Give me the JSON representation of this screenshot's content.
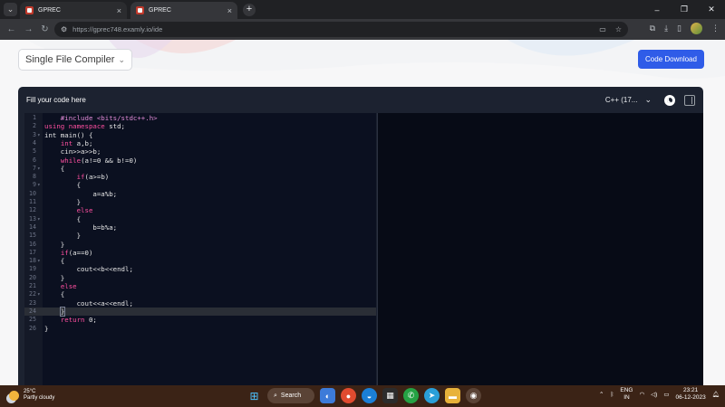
{
  "browser": {
    "tabs": [
      {
        "title": "GPREC",
        "close": "×"
      },
      {
        "title": "GPREC",
        "close": "×"
      }
    ],
    "new_tab": "+",
    "url": "https://gprec748.examly.io/ide",
    "window_controls": {
      "minimize": "–",
      "maximize": "❐",
      "close": "✕"
    }
  },
  "page": {
    "mode_select": {
      "value": "Single File Compiler",
      "chevron": "⌄"
    },
    "download_button": "Code Download",
    "panel": {
      "title": "Fill your code here",
      "language": "C++ (17...",
      "language_chevron": "⌄"
    },
    "code": [
      {
        "n": "1",
        "text": "    #include <bits/stdc++.h>",
        "fold": ""
      },
      {
        "n": "2",
        "text": "using namespace std;",
        "fold": ""
      },
      {
        "n": "3",
        "text": "int main() {",
        "fold": "▾"
      },
      {
        "n": "4",
        "text": "    int a,b;",
        "fold": ""
      },
      {
        "n": "5",
        "text": "    cin>>a>>b;",
        "fold": ""
      },
      {
        "n": "6",
        "text": "    while(a!=0 && b!=0)",
        "fold": ""
      },
      {
        "n": "7",
        "text": "    {",
        "fold": "▾"
      },
      {
        "n": "8",
        "text": "        if(a>=b)",
        "fold": ""
      },
      {
        "n": "9",
        "text": "        {",
        "fold": "▾"
      },
      {
        "n": "10",
        "text": "            a=a%b;",
        "fold": ""
      },
      {
        "n": "11",
        "text": "        }",
        "fold": ""
      },
      {
        "n": "12",
        "text": "        else",
        "fold": ""
      },
      {
        "n": "13",
        "text": "        {",
        "fold": "▾"
      },
      {
        "n": "14",
        "text": "            b=b%a;",
        "fold": ""
      },
      {
        "n": "15",
        "text": "        }",
        "fold": ""
      },
      {
        "n": "16",
        "text": "    }",
        "fold": ""
      },
      {
        "n": "17",
        "text": "    if(a==0)",
        "fold": ""
      },
      {
        "n": "18",
        "text": "    {",
        "fold": "▾"
      },
      {
        "n": "19",
        "text": "        cout<<b<<endl;",
        "fold": ""
      },
      {
        "n": "20",
        "text": "    }",
        "fold": ""
      },
      {
        "n": "21",
        "text": "    else",
        "fold": ""
      },
      {
        "n": "22",
        "text": "    {",
        "fold": "▾"
      },
      {
        "n": "23",
        "text": "        cout<<a<<endl;",
        "fold": ""
      },
      {
        "n": "24",
        "text": "    }",
        "fold": ""
      },
      {
        "n": "25",
        "text": "    return 0;",
        "fold": ""
      },
      {
        "n": "26",
        "text": "}",
        "fold": ""
      }
    ],
    "current_line": "24"
  },
  "taskbar": {
    "weather_temp": "25°C",
    "weather_desc": "Partly cloudy",
    "search_label": "Search",
    "language_1": "ENG",
    "language_2": "IN",
    "time": "23:21",
    "date": "06-12-2023"
  },
  "colors": {
    "accent_button": "#2f5ce8",
    "keyword": "#ff4fa0",
    "editor_bg": "#0b1020",
    "taskbar_bg": "#3b2316"
  }
}
